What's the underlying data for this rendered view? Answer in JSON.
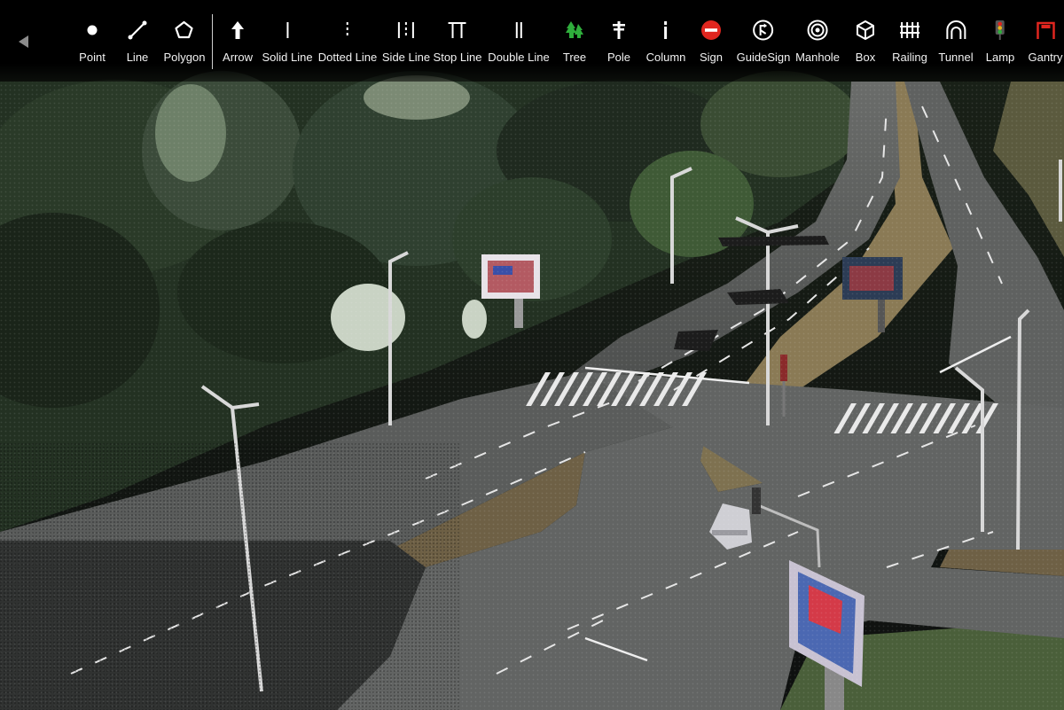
{
  "toolbar": {
    "back_icon": "back-arrow-icon",
    "tools": [
      {
        "id": "point",
        "label": "Point",
        "icon": "point-icon"
      },
      {
        "id": "line",
        "label": "Line",
        "icon": "line-icon"
      },
      {
        "id": "polygon",
        "label": "Polygon",
        "icon": "polygon-icon"
      },
      {
        "id": "arrow",
        "label": "Arrow",
        "icon": "arrow-up-icon"
      },
      {
        "id": "solid-line",
        "label": "Solid Line",
        "icon": "solid-line-icon"
      },
      {
        "id": "dotted-line",
        "label": "Dotted Line",
        "icon": "dotted-line-icon"
      },
      {
        "id": "side-line",
        "label": "Side Line",
        "icon": "side-line-icon"
      },
      {
        "id": "stop-line",
        "label": "Stop Line",
        "icon": "stop-line-icon"
      },
      {
        "id": "double-line",
        "label": "Double Line",
        "icon": "double-line-icon"
      },
      {
        "id": "tree",
        "label": "Tree",
        "icon": "tree-icon"
      },
      {
        "id": "pole",
        "label": "Pole",
        "icon": "pole-icon"
      },
      {
        "id": "column",
        "label": "Column",
        "icon": "column-icon"
      },
      {
        "id": "sign",
        "label": "Sign",
        "icon": "no-entry-sign-icon"
      },
      {
        "id": "guidesign",
        "label": "GuideSign",
        "icon": "guide-sign-icon"
      },
      {
        "id": "manhole",
        "label": "Manhole",
        "icon": "manhole-icon"
      },
      {
        "id": "box",
        "label": "Box",
        "icon": "box-icon"
      },
      {
        "id": "railing",
        "label": "Railing",
        "icon": "railing-icon"
      },
      {
        "id": "tunnel",
        "label": "Tunnel",
        "icon": "tunnel-icon"
      },
      {
        "id": "lamp",
        "label": "Lamp",
        "icon": "traffic-lamp-icon"
      },
      {
        "id": "gantry",
        "label": "Gantry",
        "icon": "gantry-icon"
      }
    ]
  },
  "colors": {
    "toolbar_bg": "#000000",
    "tree_icon": "#2fae3c",
    "sign_icon": "#e0261f",
    "gantry_icon": "#e0261f",
    "road": "#5b5d5c",
    "vegetation": "#263322"
  }
}
